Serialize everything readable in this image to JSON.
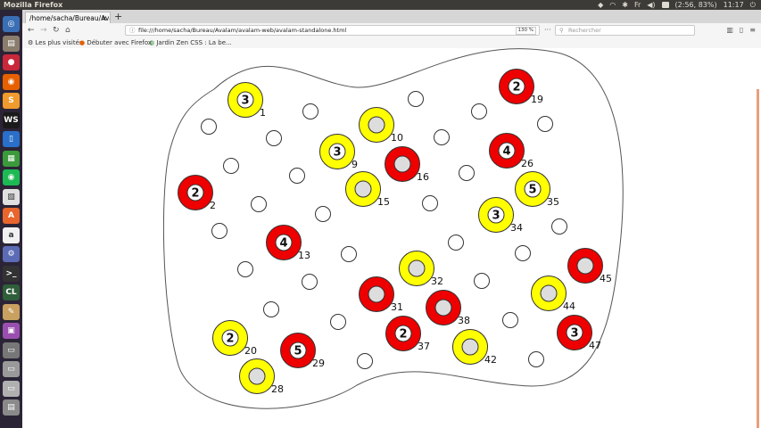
{
  "topbar": {
    "title": "Mozilla Firefox",
    "battery": "(2:56, 83%)",
    "time": "11:17",
    "keyboard": "Fr"
  },
  "launcher": {
    "icons": [
      {
        "name": "dash-icon",
        "glyph": "◎",
        "color": "#3a6fb5"
      },
      {
        "name": "files-icon",
        "glyph": "▤",
        "color": "#8a7d6c"
      },
      {
        "name": "red-app-icon",
        "glyph": "●",
        "color": "#c8283a"
      },
      {
        "name": "firefox-icon",
        "glyph": "◉",
        "color": "#e66000"
      },
      {
        "name": "sublime-icon",
        "glyph": "S",
        "color": "#f09b2d"
      },
      {
        "name": "webstorm-icon",
        "glyph": "WS",
        "color": "#1a1a1a"
      },
      {
        "name": "writer-icon",
        "glyph": "▯",
        "color": "#2a6fc9"
      },
      {
        "name": "calc-icon",
        "glyph": "▦",
        "color": "#3b9a3b"
      },
      {
        "name": "spotify-icon",
        "glyph": "◉",
        "color": "#1db954"
      },
      {
        "name": "package-icon",
        "glyph": "▧",
        "color": "#e0e0e0"
      },
      {
        "name": "software-icon",
        "glyph": "A",
        "color": "#e8662c"
      },
      {
        "name": "amazon-icon",
        "glyph": "a",
        "color": "#f1f1f1"
      },
      {
        "name": "settings-icon",
        "glyph": "⚙",
        "color": "#5b6bb5"
      },
      {
        "name": "terminal-icon",
        "glyph": ">_",
        "color": "#333333"
      },
      {
        "name": "cl-icon",
        "glyph": "CL",
        "color": "#2f5e3b"
      },
      {
        "name": "editor-icon",
        "glyph": "✎",
        "color": "#c8a060"
      },
      {
        "name": "monitor-icon",
        "glyph": "▣",
        "color": "#9a4fb0"
      },
      {
        "name": "disk-icon",
        "glyph": "▭",
        "color": "#777777"
      },
      {
        "name": "drive-icon",
        "glyph": "▭",
        "color": "#9a9a9a"
      },
      {
        "name": "drive2-icon",
        "glyph": "▭",
        "color": "#b0b0b0"
      },
      {
        "name": "trash-icon",
        "glyph": "▤",
        "color": "#8a8a8a"
      }
    ]
  },
  "tab": {
    "title": "/home/sacha/Bureau/Avala",
    "close": "×"
  },
  "newtab": "+",
  "nav": {
    "url": "file:///home/sacha/Bureau/Avalam/avalam-web/avalam-standalone.html",
    "zoom": "130 %",
    "search_placeholder": "Rechercher"
  },
  "bookmarks": [
    {
      "label": "Les plus visités"
    },
    {
      "label": "Débuter avec Firefox"
    },
    {
      "label": "Jardin Zen CSS : La be..."
    }
  ],
  "colors": {
    "red": "#ee0000",
    "yellow": "#ffff00",
    "emptyCenter": "#dddddd"
  },
  "board": {
    "pieces": [
      {
        "color": "yellow",
        "height": "3",
        "index": "1"
      },
      {
        "color": "red",
        "height": "2",
        "index": "2"
      },
      {
        "color": "yellow",
        "height": "3",
        "index": "9"
      },
      {
        "color": "yellow",
        "height": "",
        "index": "10"
      },
      {
        "color": "yellow",
        "height": "",
        "index": "15"
      },
      {
        "color": "red",
        "height": "",
        "index": "16"
      },
      {
        "color": "red",
        "height": "2",
        "index": "19"
      },
      {
        "color": "yellow",
        "height": "2",
        "index": "20"
      },
      {
        "color": "red",
        "height": "4",
        "index": "26"
      },
      {
        "color": "yellow",
        "height": "",
        "index": "28"
      },
      {
        "color": "red",
        "height": "5",
        "index": "29"
      },
      {
        "color": "red",
        "height": "",
        "index": "31"
      },
      {
        "color": "yellow",
        "height": "",
        "index": "32"
      },
      {
        "color": "yellow",
        "height": "3",
        "index": "34"
      },
      {
        "color": "yellow",
        "height": "5",
        "index": "35"
      },
      {
        "color": "red",
        "height": "2",
        "index": "37"
      },
      {
        "color": "red",
        "height": "",
        "index": "38"
      },
      {
        "color": "red",
        "height": "4",
        "index": "13"
      },
      {
        "color": "yellow",
        "height": "",
        "index": "42"
      },
      {
        "color": "yellow",
        "height": "",
        "index": "44"
      },
      {
        "color": "red",
        "height": "",
        "index": "45"
      },
      {
        "color": "red",
        "height": "3",
        "index": "47"
      }
    ]
  }
}
